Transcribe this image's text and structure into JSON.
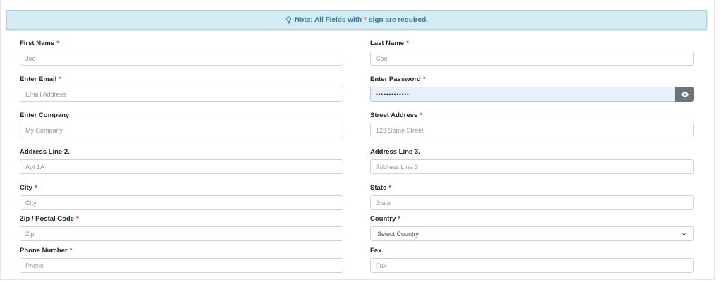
{
  "note": {
    "prefix": "Note: All Fields with",
    "star": "*",
    "suffix": "sign are required."
  },
  "required_marker": "*",
  "fields": {
    "first_name": {
      "label": "First Name",
      "required": true,
      "placeholder": "Joe"
    },
    "last_name": {
      "label": "Last Name",
      "required": true,
      "placeholder": "Cool"
    },
    "email": {
      "label": "Enter Email",
      "required": true,
      "placeholder": "Email Address"
    },
    "password": {
      "label": "Enter Password",
      "required": true,
      "value": "•••••••••••••"
    },
    "company": {
      "label": "Enter Company",
      "required": false,
      "placeholder": "My Company"
    },
    "street": {
      "label": "Street Address",
      "required": true,
      "placeholder": "123 Some Street"
    },
    "address2": {
      "label": "Address Line 2.",
      "required": false,
      "placeholder": "Apt 1A"
    },
    "address3": {
      "label": "Address Line 3.",
      "required": false,
      "placeholder": "Address Line 3"
    },
    "city": {
      "label": "City",
      "required": true,
      "placeholder": "City"
    },
    "state": {
      "label": "State",
      "required": true,
      "placeholder": "State"
    },
    "zip": {
      "label": "Zip / Postal Code",
      "required": true,
      "placeholder": "Zip"
    },
    "country": {
      "label": "Country",
      "required": true,
      "selected": "Select Country"
    },
    "phone": {
      "label": "Phone Number",
      "required": true,
      "placeholder": "Phone"
    },
    "fax": {
      "label": "Fax",
      "required": false,
      "placeholder": "Fax"
    }
  },
  "icons": {
    "note": "lightbulb-icon",
    "password_toggle": "eye-icon",
    "country_dropdown": "chevron-down-icon"
  },
  "colors": {
    "note_bg": "#d5ebf5",
    "note_text": "#2f7f9b",
    "required_star": "#dc3545",
    "eye_button": "#6c757d",
    "password_autofill_bg": "#e8f0fe"
  }
}
